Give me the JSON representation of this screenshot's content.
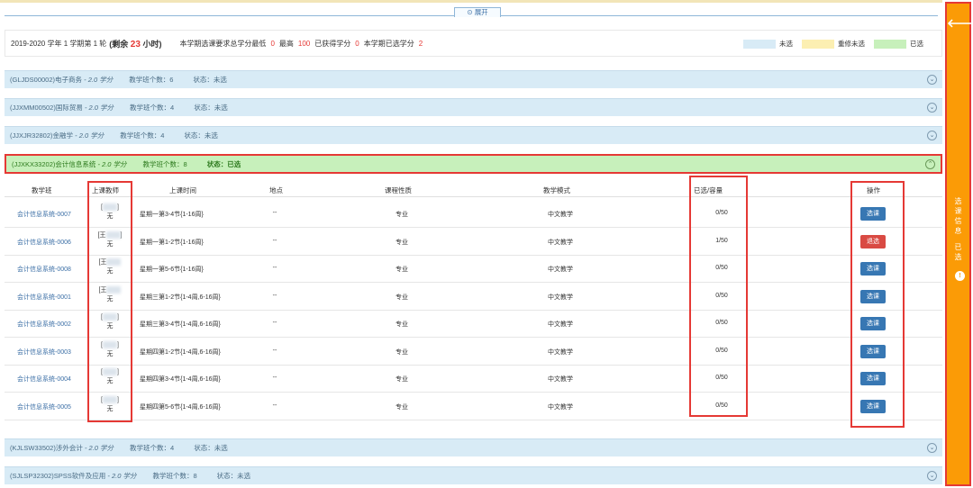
{
  "topbar": {
    "expand_label": "展开"
  },
  "summary": {
    "term": "2019-2020 学年 1 学期第 1 轮",
    "remaining_prefix": "(剩余",
    "remaining_hours": "23",
    "remaining_suffix": "小时)",
    "requirement": "本学期选课要求总学分最低",
    "min_credit": "0",
    "max_label": "最高",
    "max_credit": "100",
    "earned_label": "已获得学分",
    "earned_credit": "0",
    "selected_label": "本学期已选学分",
    "selected_credit": "2"
  },
  "legend": {
    "items": [
      {
        "label": "未选",
        "color": "#d8ebf6"
      },
      {
        "label": "重修未选",
        "color": "#fcefb2"
      },
      {
        "label": "已选",
        "color": "#c7f0bb"
      }
    ]
  },
  "courses": [
    {
      "code": "(GLJDS00002)电子商务",
      "credit": "- 2.0 学分",
      "count": "教学班个数：6",
      "status": "状态：未选"
    },
    {
      "code": "(JJXMM00502)国际贸易",
      "credit": "- 2.0 学分",
      "count": "教学班个数：4",
      "status": "状态：未选"
    },
    {
      "code": "(JJXJR32802)金融学",
      "credit": "- 2.0 学分",
      "count": "教学班个数：4",
      "status": "状态：未选"
    },
    {
      "code": "(JJXKX33202)会计信息系统",
      "credit": "- 2.0 学分",
      "count": "教学班个数：8",
      "status": "状态：已选"
    },
    {
      "code": "(KJLSW33502)涉外会计",
      "credit": "- 2.0 学分",
      "count": "教学班个数：4",
      "status": "状态：未选"
    },
    {
      "code": "(SJLSP32302)SPSS软件及应用",
      "credit": "- 2.0 学分",
      "count": "教学班个数：8",
      "status": "状态：未选"
    }
  ],
  "table": {
    "headers": {
      "class": "教学班",
      "teacher": "上课教师",
      "time": "上课时间",
      "place": "地点",
      "nature": "课程性质",
      "mode": "教学模式",
      "capacity": "已选/容量",
      "op": "操作"
    },
    "rows": [
      {
        "class": "会计信息系统-0007",
        "teacher_open": "[",
        "teacher_close": "]",
        "teacher_sub": "无",
        "time": "星期一第3-4节{1-16周}",
        "place": "--",
        "nature": "专业",
        "mode": "中文教学",
        "capacity": "0/50",
        "op": "选课"
      },
      {
        "class": "会计信息系统-0006",
        "teacher_open": "[王",
        "teacher_close": "]",
        "teacher_sub": "无",
        "time": "星期一第1-2节{1-16周}",
        "place": "--",
        "nature": "专业",
        "mode": "中文教学",
        "capacity": "1/50",
        "op": "退选"
      },
      {
        "class": "会计信息系统-0008",
        "teacher_open": "[王",
        "teacher_close": "",
        "teacher_sub": "无",
        "time": "星期一第5-6节{1-16周}",
        "place": "--",
        "nature": "专业",
        "mode": "中文教学",
        "capacity": "0/50",
        "op": "选课"
      },
      {
        "class": "会计信息系统-0001",
        "teacher_open": "[王",
        "teacher_close": "",
        "teacher_sub": "无",
        "time": "星期三第1-2节{1-4周,6-16周}",
        "place": "--",
        "nature": "专业",
        "mode": "中文教学",
        "capacity": "0/50",
        "op": "选课"
      },
      {
        "class": "会计信息系统-0002",
        "teacher_open": "[",
        "teacher_close": "]",
        "teacher_sub": "无",
        "time": "星期三第3-4节{1-4周,6-16周}",
        "place": "--",
        "nature": "专业",
        "mode": "中文教学",
        "capacity": "0/50",
        "op": "选课"
      },
      {
        "class": "会计信息系统-0003",
        "teacher_open": "[",
        "teacher_close": "]",
        "teacher_sub": "无",
        "time": "星期四第1-2节{1-4周,6-16周}",
        "place": "--",
        "nature": "专业",
        "mode": "中文教学",
        "capacity": "0/50",
        "op": "选课"
      },
      {
        "class": "会计信息系统-0004",
        "teacher_open": "[",
        "teacher_close": "]",
        "teacher_sub": "无",
        "time": "星期四第3-4节{1-4周,6-16周}",
        "place": "--",
        "nature": "专业",
        "mode": "中文教学",
        "capacity": "0/50",
        "op": "选课"
      },
      {
        "class": "会计信息系统-0005",
        "teacher_open": "[",
        "teacher_close": "]",
        "teacher_sub": "无",
        "time": "星期四第5-6节{1-4周,6-16周}",
        "place": "--",
        "nature": "专业",
        "mode": "中文教学",
        "capacity": "0/50",
        "op": "选课"
      }
    ]
  },
  "sidebar": {
    "arrow_icon": "left-arrow-icon",
    "chars": [
      "选",
      "课",
      "信",
      "息"
    ],
    "selected_chars": [
      "已",
      "选"
    ],
    "badge": "!"
  }
}
